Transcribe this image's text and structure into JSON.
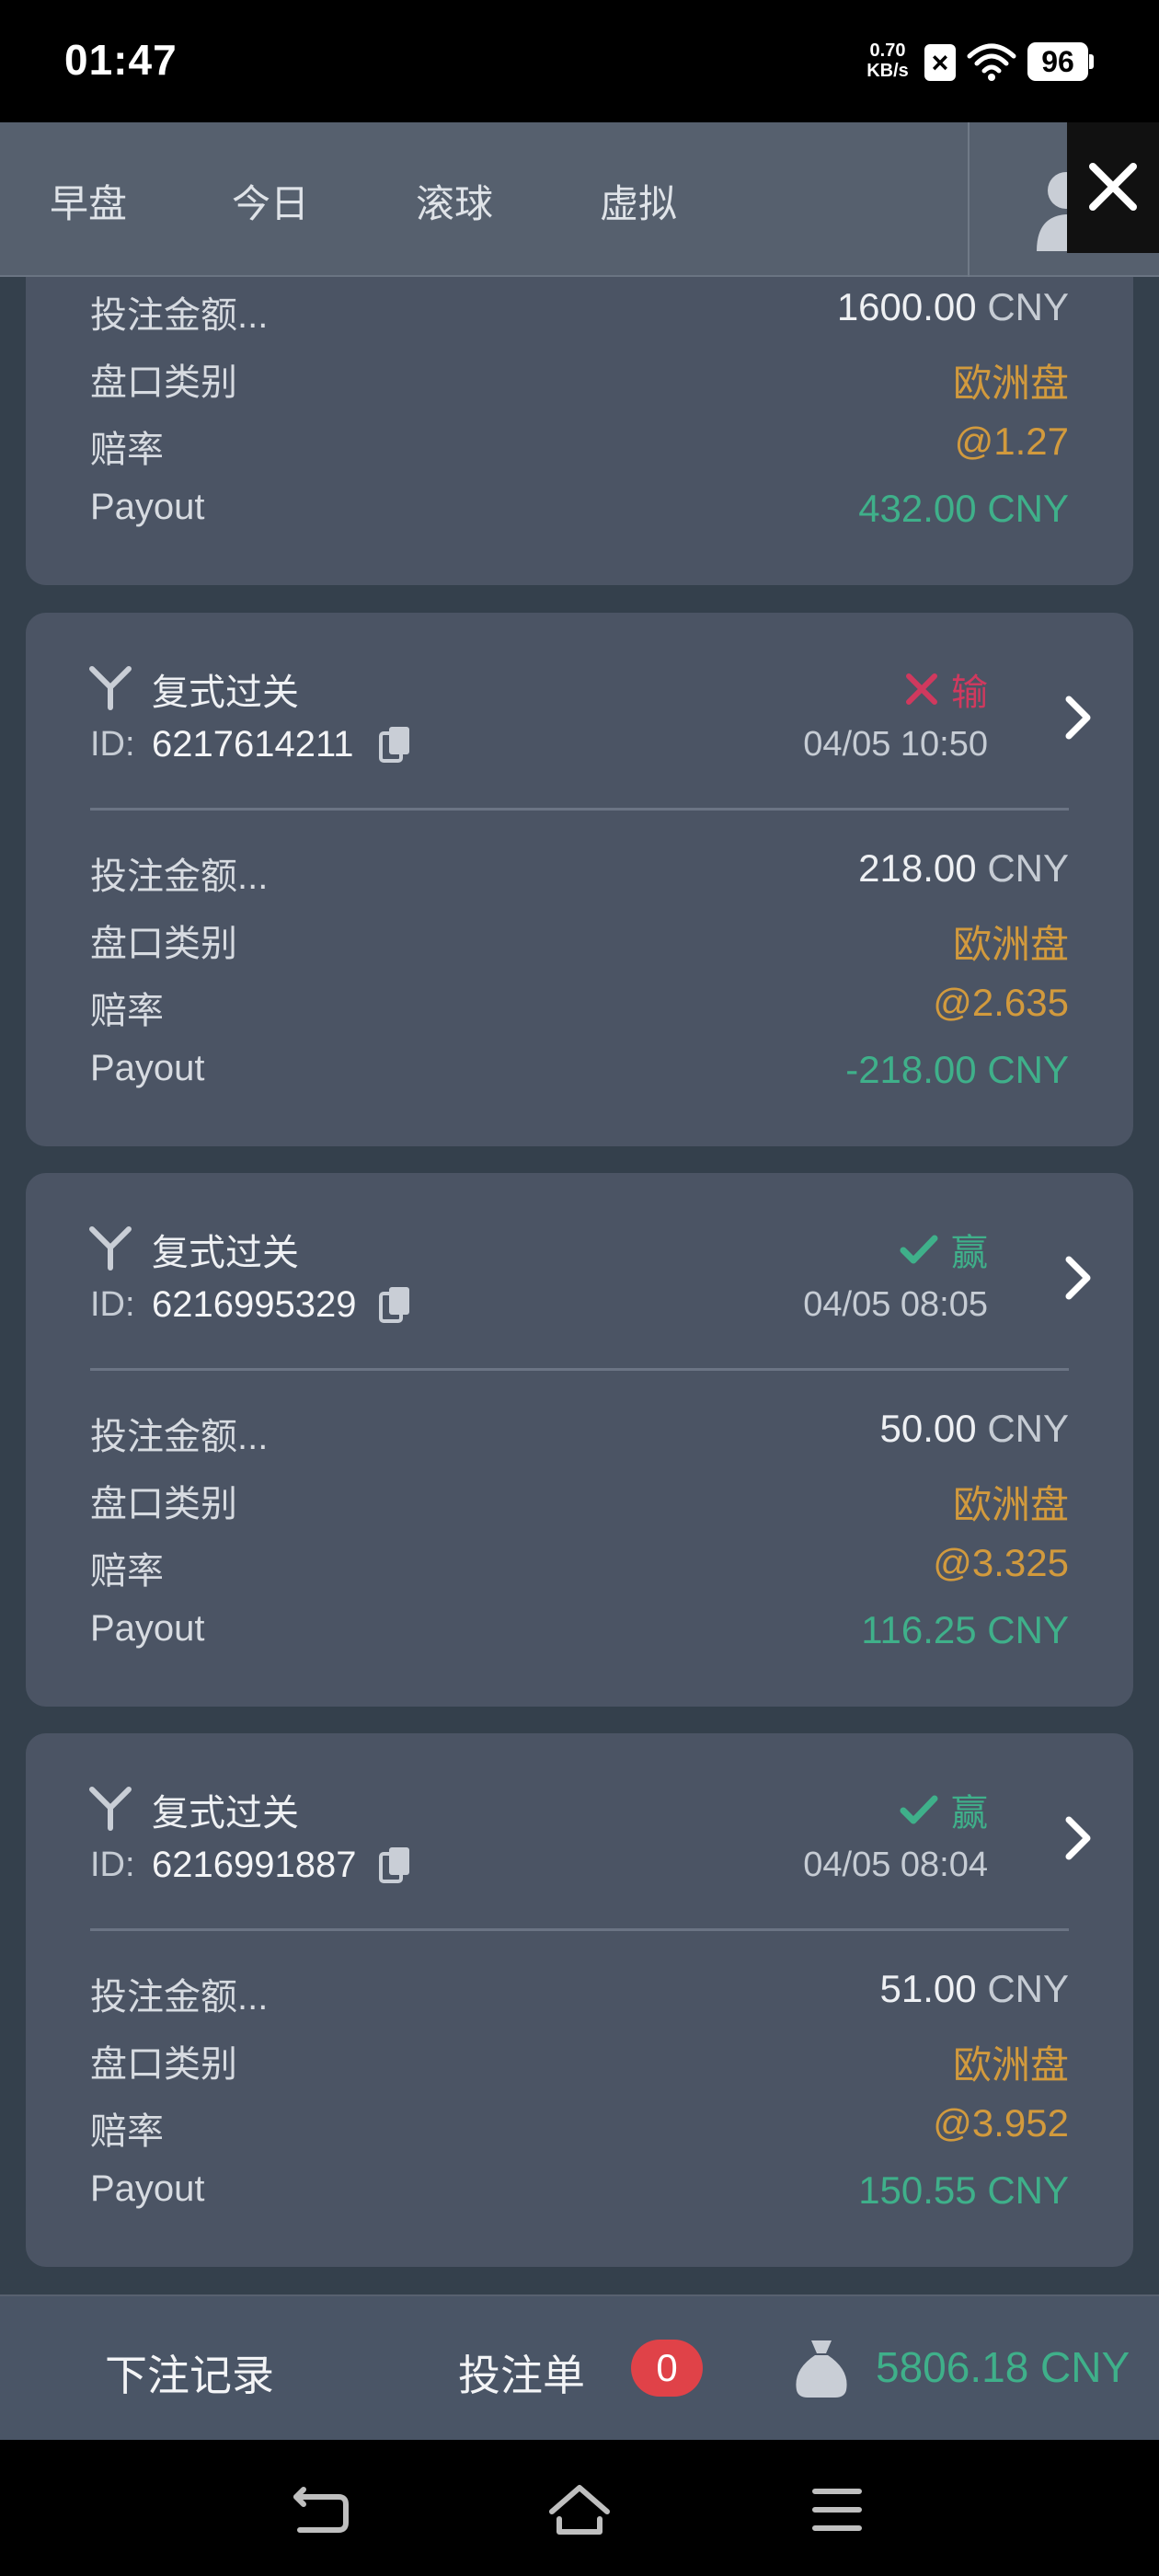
{
  "status_bar": {
    "time": "01:47",
    "net_speed_value": "0.70",
    "net_speed_unit": "KB/s",
    "sim_status": "×",
    "battery": "96"
  },
  "nav": {
    "tabs": [
      {
        "label": "早盘"
      },
      {
        "label": "今日"
      },
      {
        "label": "滚球"
      },
      {
        "label": "虚拟"
      }
    ],
    "icons": [
      "user-icon",
      "close-icon"
    ]
  },
  "partial_card": {
    "rows": [
      {
        "label": "投注金额...",
        "value": "1600.00",
        "unit": "CNY"
      },
      {
        "label": "盘口类别",
        "value": "欧洲盘"
      },
      {
        "label": "赔率",
        "value": "@1.27"
      },
      {
        "label": "Payout",
        "value": "432.00 CNY"
      }
    ]
  },
  "cards": [
    {
      "type": "复式过关",
      "id_label": "ID:",
      "id": "6217614211",
      "status_text": "输",
      "status": "lose",
      "datetime": "04/05 10:50",
      "rows": [
        {
          "label": "投注金额...",
          "value": "218.00",
          "unit": "CNY"
        },
        {
          "label": "盘口类别",
          "value": "欧洲盘"
        },
        {
          "label": "赔率",
          "value": "@2.635"
        },
        {
          "label": "Payout",
          "value": "-218.00 CNY"
        }
      ]
    },
    {
      "type": "复式过关",
      "id_label": "ID:",
      "id": "6216995329",
      "status_text": "赢",
      "status": "win",
      "datetime": "04/05 08:05",
      "rows": [
        {
          "label": "投注金额...",
          "value": "50.00",
          "unit": "CNY"
        },
        {
          "label": "盘口类别",
          "value": "欧洲盘"
        },
        {
          "label": "赔率",
          "value": "@3.325"
        },
        {
          "label": "Payout",
          "value": "116.25 CNY"
        }
      ]
    },
    {
      "type": "复式过关",
      "id_label": "ID:",
      "id": "6216991887",
      "status_text": "赢",
      "status": "win",
      "datetime": "04/05 08:04",
      "rows": [
        {
          "label": "投注金额...",
          "value": "51.00",
          "unit": "CNY"
        },
        {
          "label": "盘口类别",
          "value": "欧洲盘"
        },
        {
          "label": "赔率",
          "value": "@3.952"
        },
        {
          "label": "Payout",
          "value": "150.55 CNY"
        }
      ]
    }
  ],
  "bottom_bar": {
    "records_label": "下注记录",
    "slip_label": "投注单",
    "slip_count": "0",
    "balance": "5806.18 CNY"
  },
  "colors": {
    "background": "#34404c",
    "card": "#4b5464",
    "win": "#3fb08a",
    "lose": "#d0395e",
    "odds": "#d29a3d",
    "badge": "#e04248"
  }
}
